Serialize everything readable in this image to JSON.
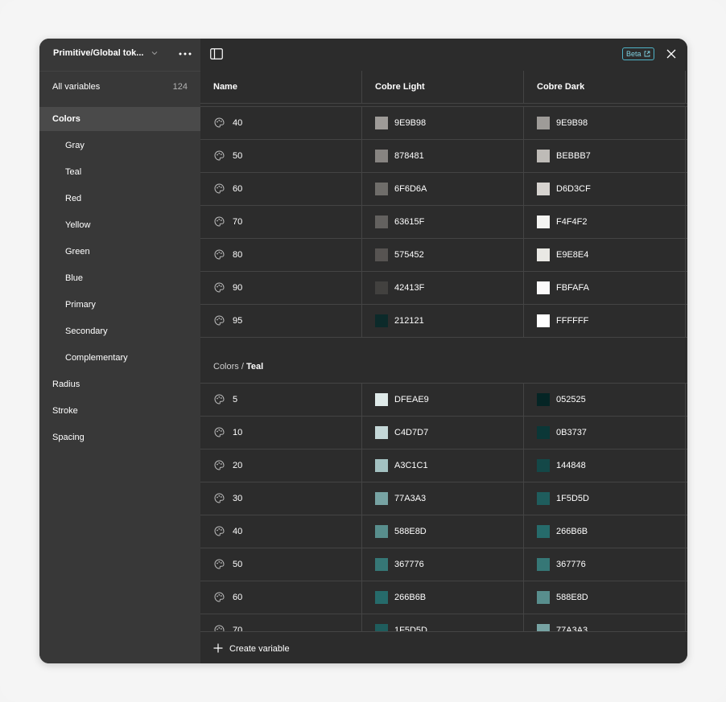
{
  "sidebar": {
    "collection_name": "Primitive/Global tok...",
    "all_variables_label": "All variables",
    "all_variables_count": "124",
    "groups": [
      {
        "label": "Colors",
        "indent": 0,
        "active": true
      },
      {
        "label": "Gray",
        "indent": 1
      },
      {
        "label": "Teal",
        "indent": 1
      },
      {
        "label": "Red",
        "indent": 1
      },
      {
        "label": "Yellow",
        "indent": 1
      },
      {
        "label": "Green",
        "indent": 1
      },
      {
        "label": "Blue",
        "indent": 1
      },
      {
        "label": "Primary",
        "indent": 1
      },
      {
        "label": "Secondary",
        "indent": 1
      },
      {
        "label": "Complementary",
        "indent": 1
      },
      {
        "label": "Radius",
        "indent": 0
      },
      {
        "label": "Stroke",
        "indent": 0
      },
      {
        "label": "Spacing",
        "indent": 0
      }
    ]
  },
  "topbar": {
    "beta_label": "Beta"
  },
  "columns": [
    "Name",
    "Cobre Light",
    "Cobre Dark"
  ],
  "gray_rows": [
    {
      "name": "40",
      "light": "9E9B98",
      "dark": "9E9B98"
    },
    {
      "name": "50",
      "light": "878481",
      "dark": "BEBBB7"
    },
    {
      "name": "60",
      "light": "6F6D6A",
      "dark": "D6D3CF"
    },
    {
      "name": "70",
      "light": "63615F",
      "dark": "F4F4F2"
    },
    {
      "name": "80",
      "light": "575452",
      "dark": "E9E8E4"
    },
    {
      "name": "90",
      "light": "42413F",
      "dark": "FBFAFA"
    },
    {
      "name": "95",
      "light": "212121",
      "dark": "FFFFFF",
      "light_swatch": "#0c2a2a"
    }
  ],
  "teal_section": {
    "prefix": "Colors",
    "separator": " / ",
    "group": "Teal"
  },
  "teal_rows": [
    {
      "name": "5",
      "light": "DFEAE9",
      "dark": "052525"
    },
    {
      "name": "10",
      "light": "C4D7D7",
      "dark": "0B3737"
    },
    {
      "name": "20",
      "light": "A3C1C1",
      "dark": "144848"
    },
    {
      "name": "30",
      "light": "77A3A3",
      "dark": "1F5D5D"
    },
    {
      "name": "40",
      "light": "588E8D",
      "dark": "266B6B"
    },
    {
      "name": "50",
      "light": "367776",
      "dark": "367776"
    },
    {
      "name": "60",
      "light": "266B6B",
      "dark": "588E8D"
    },
    {
      "name": "70",
      "light": "1F5D5D",
      "dark": "77A3A3"
    }
  ],
  "footer": {
    "create_label": "Create variable"
  }
}
